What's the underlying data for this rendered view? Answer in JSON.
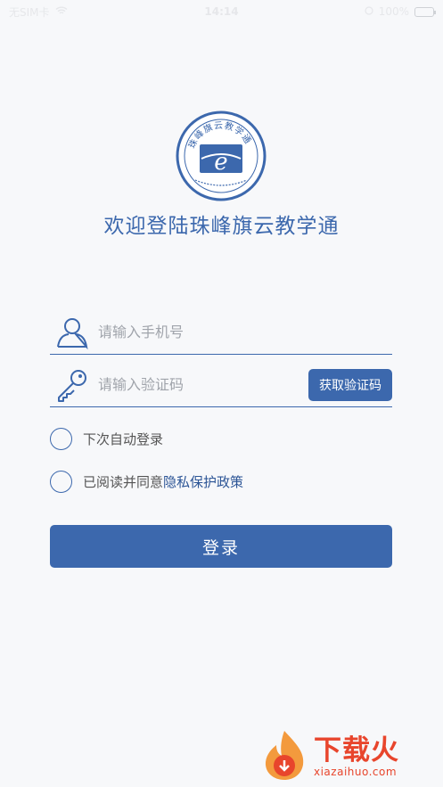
{
  "status_bar": {
    "carrier": "无SIM卡",
    "time": "14:14",
    "battery": "100%"
  },
  "app": {
    "title": "欢迎登陆珠峰旗云教学通",
    "logo_text": "珠峰旗云教学通"
  },
  "form": {
    "phone_placeholder": "请输入手机号",
    "code_placeholder": "请输入验证码",
    "get_code_label": "获取验证码",
    "auto_login_label": "下次自动登录",
    "agree_prefix": "已阅读并同意",
    "privacy_link_label": "隐私保护政策",
    "login_label": "登录"
  },
  "watermark": {
    "cn": "下载火",
    "en": "xiazaihuo.com"
  },
  "colors": {
    "accent": "#3c68ad",
    "background": "#f7f8fa",
    "watermark": "#e8452c"
  }
}
